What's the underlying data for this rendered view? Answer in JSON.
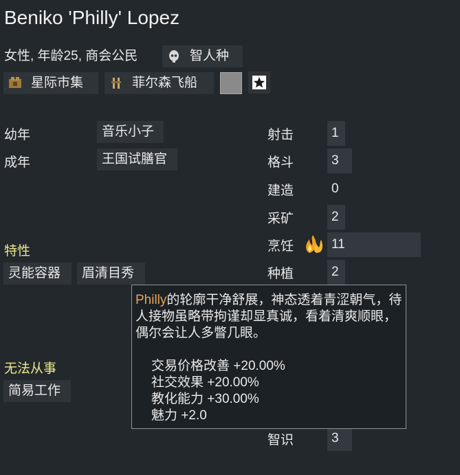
{
  "pawn": {
    "name": "Beniko 'Philly' Lopez",
    "info": "女性, 年龄25, 商会公民",
    "xenotype": "智人种",
    "faction": "星际市集",
    "ideo": "菲尔森飞船"
  },
  "backstory": [
    {
      "label": "幼年",
      "value": "音乐小子"
    },
    {
      "label": "成年",
      "value": "王国试膳官"
    }
  ],
  "traits": {
    "heading": "特性",
    "items": [
      "灵能容器",
      "眉清目秀"
    ]
  },
  "incapable": {
    "heading": "无法从事",
    "items": [
      "简易工作"
    ]
  },
  "skills": [
    {
      "name": "射击",
      "level": "1",
      "bar_fraction": 0.05,
      "passion": ""
    },
    {
      "name": "格斗",
      "level": "3",
      "bar_fraction": 0.15,
      "passion": ""
    },
    {
      "name": "建造",
      "level": "0",
      "bar_fraction": 0.0,
      "passion": ""
    },
    {
      "name": "采矿",
      "level": "2",
      "bar_fraction": 0.1,
      "passion": ""
    },
    {
      "name": "烹饪",
      "level": "11",
      "bar_fraction": 0.55,
      "passion": "major"
    },
    {
      "name": "种植",
      "level": "2",
      "bar_fraction": 0.1,
      "passion": ""
    },
    {
      "name": "智识",
      "level": "3",
      "bar_fraction": 0.15,
      "passion": ""
    }
  ],
  "tooltip": {
    "name": "Philly",
    "description": "的轮廓干净舒展，神态透着青涩朝气，待人接物虽略带拘谨却显真诚，看着清爽顺眼，偶尔会让人多瞥几眼。",
    "effects": [
      "交易价格改善 +20.00%",
      "社交效果 +20.00%",
      "教化能力 +30.00%",
      "魅力 +2.0"
    ]
  },
  "colors": {
    "background": "#23282d",
    "chip": "#2f3439",
    "heading_yellow": "#ece88c",
    "tooltip_name": "#e7a45a",
    "passion_flame": "#f0a020"
  },
  "icons": {
    "xenotype": "skull-icon",
    "faction": "faction-icon",
    "ideo": "ideoligion-icon",
    "favorite": "star-icon",
    "passion": "flame-icon"
  }
}
